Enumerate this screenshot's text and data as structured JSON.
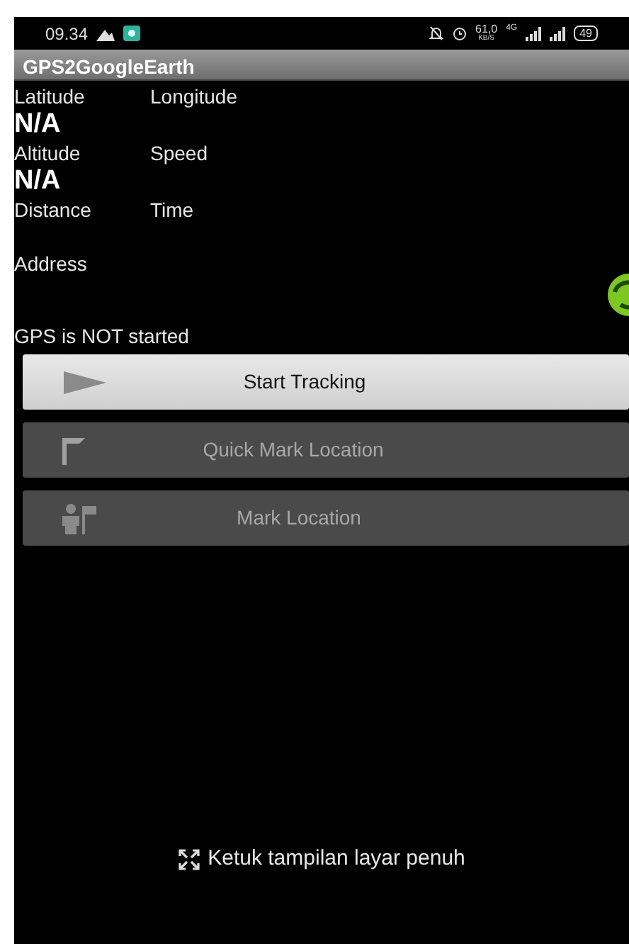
{
  "status_bar": {
    "time": "09.34",
    "speed": "61,0",
    "speed_unit": "KB/S",
    "network": "4G",
    "battery": "49"
  },
  "window": {
    "title": "GPS2GoogleEarth"
  },
  "fields": [
    {
      "label": "Latitude",
      "label_2": "Longitude",
      "value": "N/A"
    },
    {
      "label": "Altitude",
      "label_2": "Speed",
      "value": "N/A"
    },
    {
      "label": "Distance",
      "label_2": "Time"
    }
  ],
  "address": {
    "label": "Address"
  },
  "gps_status": "GPS is NOT started",
  "buttons": [
    {
      "label": "Start Tracking",
      "kind": "play",
      "disabled": false
    },
    {
      "label": "Quick Mark Location",
      "kind": "flag",
      "disabled": true
    },
    {
      "label": "Mark Location",
      "kind": "person-flag",
      "disabled": true
    }
  ],
  "fullscreen_hint": "Ketuk tampilan layar penuh"
}
